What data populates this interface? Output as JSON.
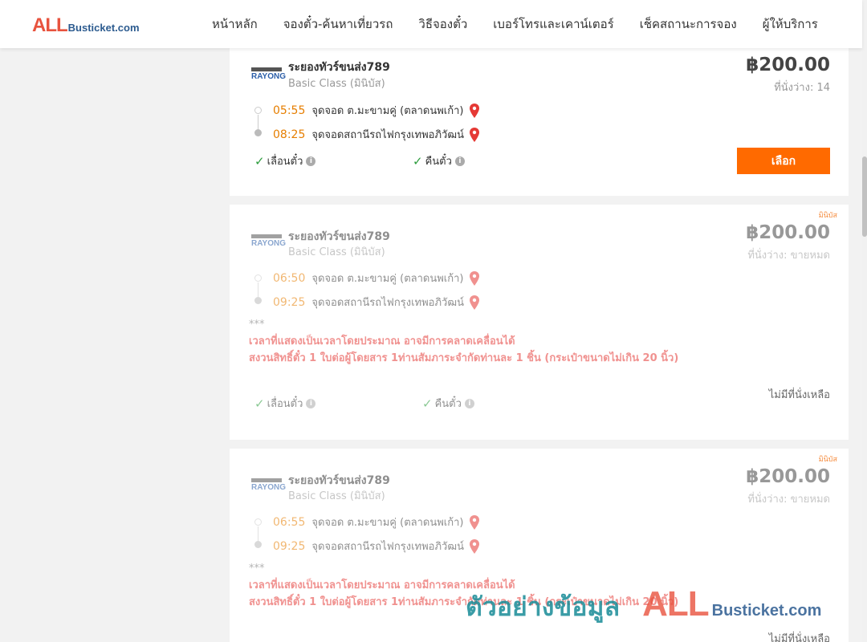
{
  "header": {
    "logo_main": "ALL",
    "logo_sub": "Busticket.com",
    "nav": [
      "หน้าหลัก",
      "จองตั๋ว-ค้นหาเที่ยวรถ",
      "วิธีจองตั๋ว",
      "เบอร์โทรและเคาน์เตอร์",
      "เช็คสถานะการจอง",
      "ผู้ให้บริการ"
    ]
  },
  "trips": [
    {
      "operator_logo": "RAYONG",
      "operator": "ระยองทัวร์ขนส่ง789",
      "bus_class": "Basic Class (มินิบัส)",
      "price": "฿200.00",
      "seats": "ที่นั่งว่าง: 14",
      "depart_time": "05:55",
      "depart_place": "จุดจอด ต.มะขามคู่ (ตลาดนพเก้า)",
      "arrive_time": "08:25",
      "arrive_place": "จุดจอดสถานีรถไฟกรุงเทพอภิวัฒน์",
      "feature_1": "เลื่อนตั๋ว",
      "feature_2": "คืนตั๋ว",
      "action": "เลือก"
    },
    {
      "tag": "มินิบัส",
      "operator_logo": "RAYONG",
      "operator": "ระยองทัวร์ขนส่ง789",
      "bus_class": "Basic Class (มินิบัส)",
      "price": "฿200.00",
      "seats": "ที่นั่งว่าง: ขายหมด",
      "depart_time": "06:50",
      "depart_place": "จุดจอด ต.มะขามคู่ (ตลาดนพเก้า)",
      "arrive_time": "09:25",
      "arrive_place": "จุดจอดสถานีรถไฟกรุงเทพอภิวัฒน์",
      "note_stars": "***",
      "note_line1": "เวลาที่แสดงเป็นเวลาโดยประมาณ อาจมีการคลาดเคลื่อนได้",
      "note_line2": "สงวนสิทธิ์ตั๋ว 1 ใบต่อผู้โดยสาร 1ท่านสัมภาระจำกัดท่านละ 1 ชิ้น (กระเป๋าขนาดไม่เกิน 20 นิ้ว)",
      "feature_1": "เลื่อนตั๋ว",
      "feature_2": "คืนตั๋ว",
      "status": "ไม่มีที่นั่งเหลือ"
    },
    {
      "tag": "มินิบัส",
      "operator_logo": "RAYONG",
      "operator": "ระยองทัวร์ขนส่ง789",
      "bus_class": "Basic Class (มินิบัส)",
      "price": "฿200.00",
      "seats": "ที่นั่งว่าง: ขายหมด",
      "depart_time": "06:55",
      "depart_place": "จุดจอด ต.มะขามคู่ (ตลาดนพเก้า)",
      "arrive_time": "09:25",
      "arrive_place": "จุดจอดสถานีรถไฟกรุงเทพอภิวัฒน์",
      "note_stars": "***",
      "note_line1": "เวลาที่แสดงเป็นเวลาโดยประมาณ อาจมีการคลาดเคลื่อนได้",
      "note_line2": "สงวนสิทธิ์ตั๋ว 1 ใบต่อผู้โดยสาร 1ท่านสัมภาระจำกัดท่านละ 1 ชิ้น (กระเป๋าขนาดไม่เกิน 20 นิ้ว)",
      "status": "ไม่มีที่นั่งเหลือ"
    }
  ],
  "watermark": {
    "thai": "ตัวอย่างข้อมูล",
    "brand_main": "ALL",
    "brand_sub": "Busticket.com"
  },
  "colors": {
    "accent": "#ff6a00",
    "time": "#e67e00",
    "warning": "#e53935",
    "check": "#2e9d3e",
    "pin": "#e53935"
  },
  "icons": [
    "map-pin-icon",
    "check-icon",
    "info-icon"
  ]
}
